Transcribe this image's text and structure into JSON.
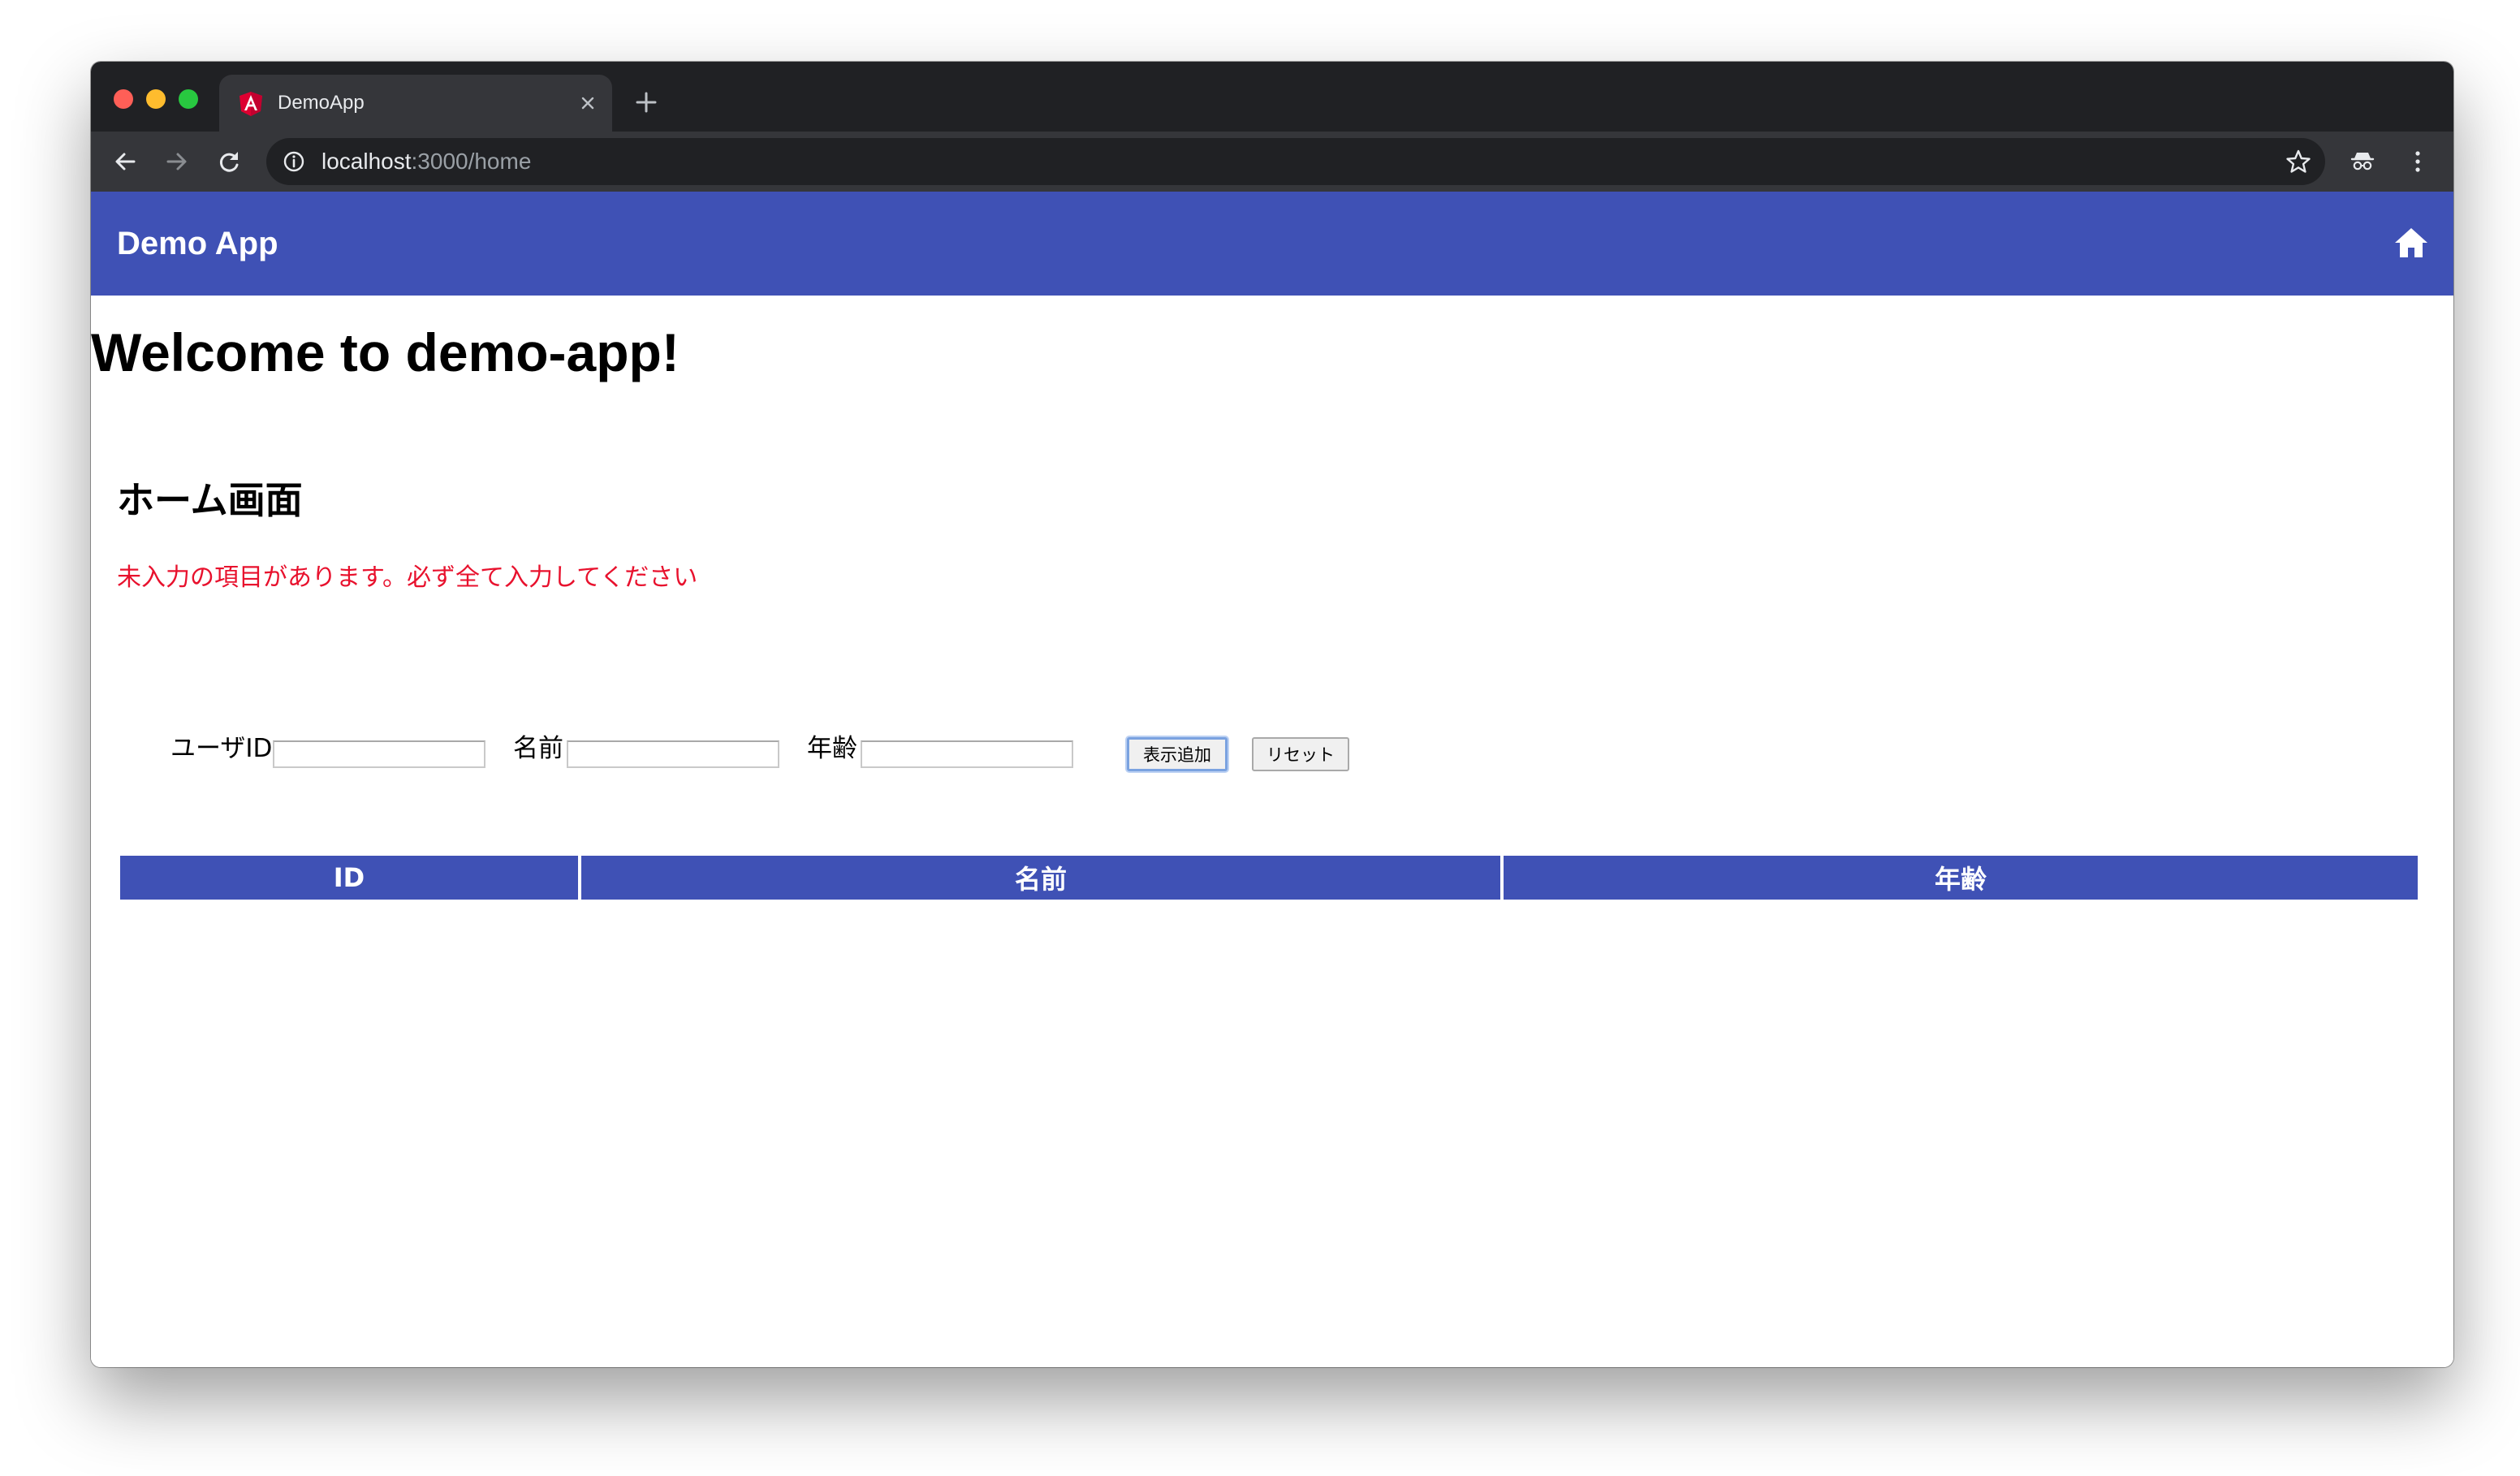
{
  "browser": {
    "tab": {
      "title": "DemoApp",
      "favicon": "angular-icon"
    },
    "address": {
      "host": "localhost",
      "path": ":3000/home"
    }
  },
  "appbar": {
    "title": "Demo App",
    "color": "#3f51b5"
  },
  "page": {
    "welcome": "Welcome to demo-app!",
    "heading": "ホーム画面",
    "error_message": "未入力の項目があります。必ず全て入力してください",
    "error_color": "#e8112d"
  },
  "form": {
    "user_id": {
      "label": "ユーザID",
      "value": ""
    },
    "name": {
      "label": "名前",
      "value": ""
    },
    "age": {
      "label": "年齢",
      "value": ""
    },
    "add_button_label": "表示追加",
    "reset_button_label": "リセット"
  },
  "table": {
    "columns": [
      "ID",
      "名前",
      "年齢"
    ],
    "rows": []
  }
}
